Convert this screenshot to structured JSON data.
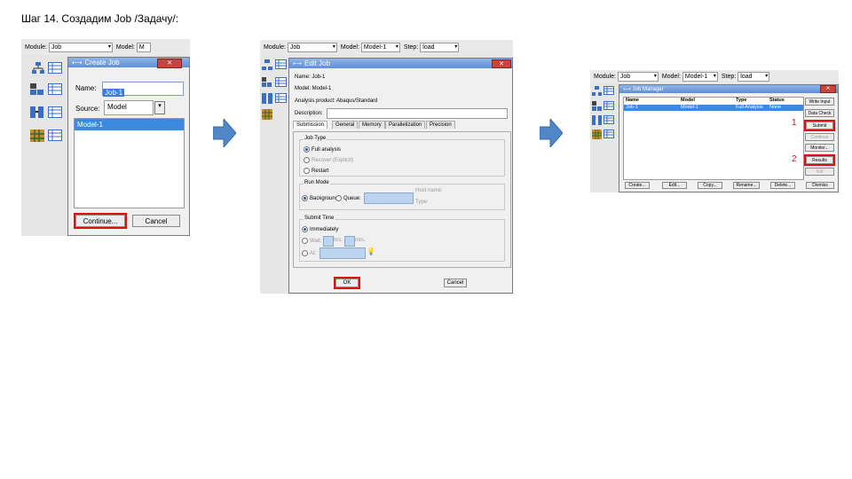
{
  "slide": {
    "title": "Шаг 14. Создадим Job /Задачу/:"
  },
  "common": {
    "module_label": "Module:",
    "module_value": "Job",
    "model_label": "Model:",
    "model_value": "Model-1",
    "step_label": "Step:",
    "step_value": "load"
  },
  "panel1": {
    "model_partial": "M",
    "dialog_title": "Create Job",
    "name_label": "Name:",
    "name_value": "Job-1",
    "source_label": "Source:",
    "source_value": "Model",
    "list_items": [
      "Model-1"
    ],
    "continue_label": "Continue...",
    "cancel_label": "Cancel"
  },
  "panel2": {
    "dialog_title": "Edit Job",
    "name_line": "Name: Job-1",
    "model_line": "Model: Model-1",
    "product_line": "Analysis product: Abaqus/Standard",
    "description_label": "Description:",
    "tabs": [
      "Submission",
      "General",
      "Memory",
      "Parallelization",
      "Precision"
    ],
    "job_type_title": "Job Type",
    "job_type_options": [
      "Full analysis",
      "Recover (Explicit)",
      "Restart"
    ],
    "run_mode_title": "Run Mode",
    "run_background": "Background",
    "run_queue": "Queue:",
    "host_name": "Host name:",
    "type_label": "Type:",
    "submit_time_title": "Submit Time",
    "submit_options": [
      "Immediately",
      "Wait:",
      "At:"
    ],
    "hrs_label": "hrs.",
    "min_label": "min.",
    "ok_label": "OK",
    "cancel_label": "Cancel"
  },
  "panel3": {
    "dialog_title": "Job Manager",
    "columns": [
      "Name",
      "Model",
      "Type",
      "Status"
    ],
    "row": [
      "Job-1",
      "Model-1",
      "Full Analysis",
      "None"
    ],
    "side_buttons": [
      "Write Input",
      "Data Check",
      "Submit",
      "Continue",
      "Monitor...",
      "Results",
      "Kill"
    ],
    "bottom_buttons": [
      "Create...",
      "Edit...",
      "Copy...",
      "Rename...",
      "Delete...",
      "Dismiss"
    ],
    "marker1": "1",
    "marker2": "2"
  },
  "colors": {
    "accent_red": "#d11111",
    "selection_blue": "#3a8be0",
    "arrow_blue": "#4f87c8"
  }
}
